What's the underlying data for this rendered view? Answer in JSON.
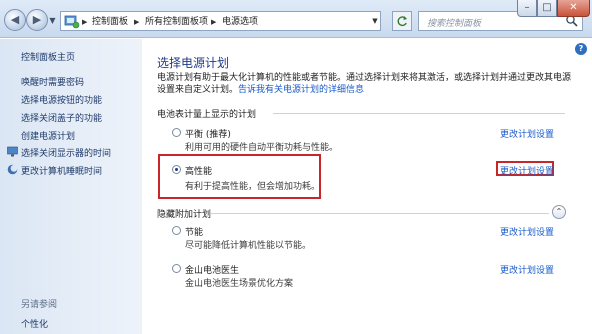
{
  "address_bar": {
    "crumbs": [
      "控制面板",
      "所有控制面板项",
      "电源选项"
    ]
  },
  "search": {
    "placeholder": "搜索控制面板"
  },
  "sidebar": {
    "home": "控制面板主页",
    "items": [
      "唤醒时需要密码",
      "选择电源按钮的功能",
      "选择关闭盖子的功能",
      "创建电源计划",
      "选择关闭显示器的时间",
      "更改计算机睡眠时间"
    ],
    "see_also_title": "另请参阅",
    "see_also": [
      "个性化"
    ]
  },
  "main": {
    "title": "选择电源计划",
    "description": "电源计划有助于最大化计算机的性能或者节能。通过选择计划来将其激活，或选择计划并通过更改其电源设置来自定义计划。",
    "description_link": "告诉我有关电源计划的详细信息",
    "section_battery": "电池表计量上显示的计划",
    "section_hidden": "隐藏附加计划",
    "change_label": "更改计划设置",
    "plans": [
      {
        "name": "平衡 (推荐)",
        "desc": "利用可用的硬件自动平衡功耗与性能。",
        "selected": false
      },
      {
        "name": "高性能",
        "desc": "有利于提高性能，但会增加功耗。",
        "selected": true
      },
      {
        "name": "节能",
        "desc": "尽可能降低计算机性能以节能。",
        "selected": false
      },
      {
        "name": "金山电池医生",
        "desc": "金山电池医生场景优化方案",
        "selected": false
      }
    ]
  },
  "colors": {
    "link": "#1a5bc8",
    "title": "#1e3a8a",
    "highlight": "#c9262b",
    "sidebar_bg": "#dbe6f4"
  }
}
